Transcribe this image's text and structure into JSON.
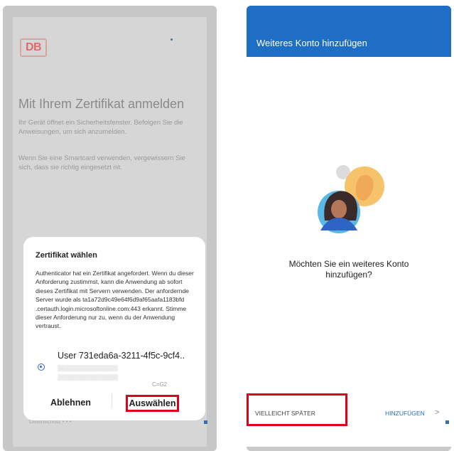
{
  "left": {
    "logo": "DB",
    "heading": "Mit Ihrem Zertifikat anmelden",
    "paragraph1": "Ihr Gerät öffnet ein Sicherheitsfenster. Befolgen Sie die Anweisungen, um sich anzumelden.",
    "paragraph2": "Wenn Sie eine Smartcard verwenden, vergewissern Sie sich, dass sie richtig eingesetzt ist.",
    "footer": "Datenschutz  • • •",
    "dialog": {
      "title": "Zertifikat wählen",
      "body": "Authenticator hat ein Zertifikat angefordert. Wenn du dieser Anforderung zustimmst, kann die Anwendung ab sofort dieses Zertifikat mit Servern verwenden. Der anfordernde Server wurde als ta1a72d9c49e64f6d9af65aafa1183bfd .certauth.login.microsoftonline.com:443 erkannt. Stimme dieser Anforderung nur zu, wenn du der Anwendung vertraust.",
      "certificate": {
        "user": "User 731eda6a-3211-4f5c-9cf4..",
        "details_blurred": "▒▒▒▒▒▒▒▒▒▒▒▒▒▒▒",
        "details_suffix": "C=G2"
      },
      "cancel_label": "Ablehnen",
      "select_label": "Auswählen"
    }
  },
  "right": {
    "title": "Weiteres Konto hinzufügen",
    "prompt": "Möchten Sie ein weiteres Konto hinzufügen?",
    "later_label": "VIELLEICHT SPÄTER",
    "add_label": "HINZUFÜGEN",
    "chevron": ">"
  },
  "colors": {
    "accent_blue": "#1e6ec5",
    "highlight_red": "#e0001b"
  }
}
